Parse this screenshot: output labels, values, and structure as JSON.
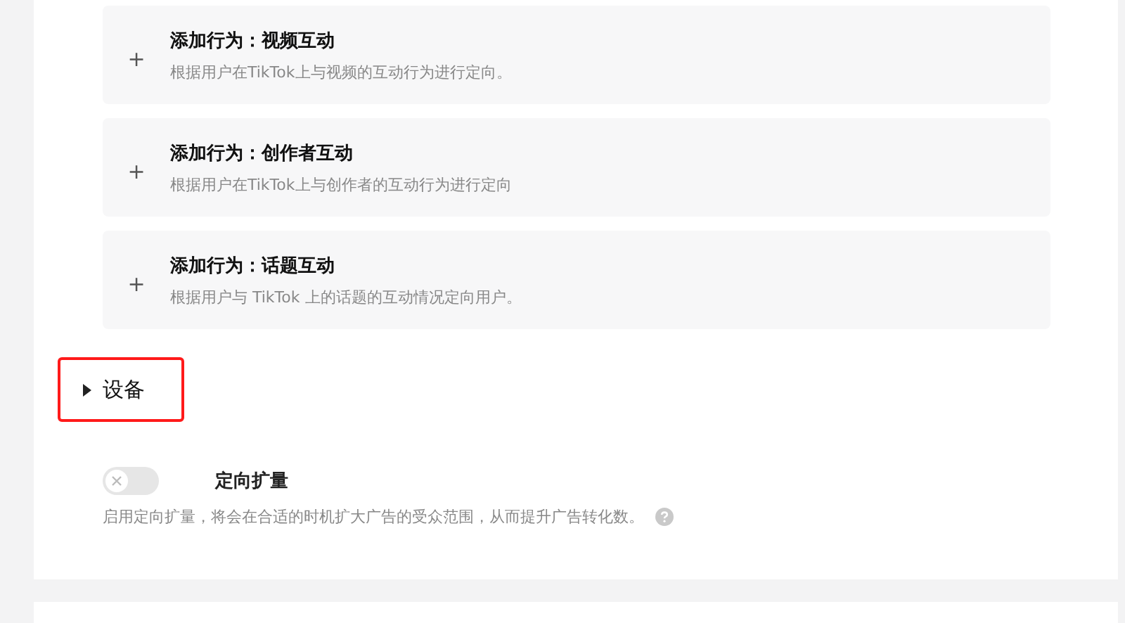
{
  "behaviors": [
    {
      "icon": "+",
      "title": "添加行为：视频互动",
      "description": "根据用户在TikTok上与视频的互动行为进行定向。"
    },
    {
      "icon": "+",
      "title": "添加行为：创作者互动",
      "description": "根据用户在TikTok上与创作者的互动行为进行定向"
    },
    {
      "icon": "+",
      "title": "添加行为：话题互动",
      "description": "根据用户与 TikTok 上的话题的互动情况定向用户。"
    }
  ],
  "section": {
    "label": "设备",
    "expanded": false,
    "highlighted": true
  },
  "expansion": {
    "label": "定向扩量",
    "on": false,
    "description": "启用定向扩量，将会在合适的时机扩大广告的受众范围，从而提升广告转化数。"
  }
}
